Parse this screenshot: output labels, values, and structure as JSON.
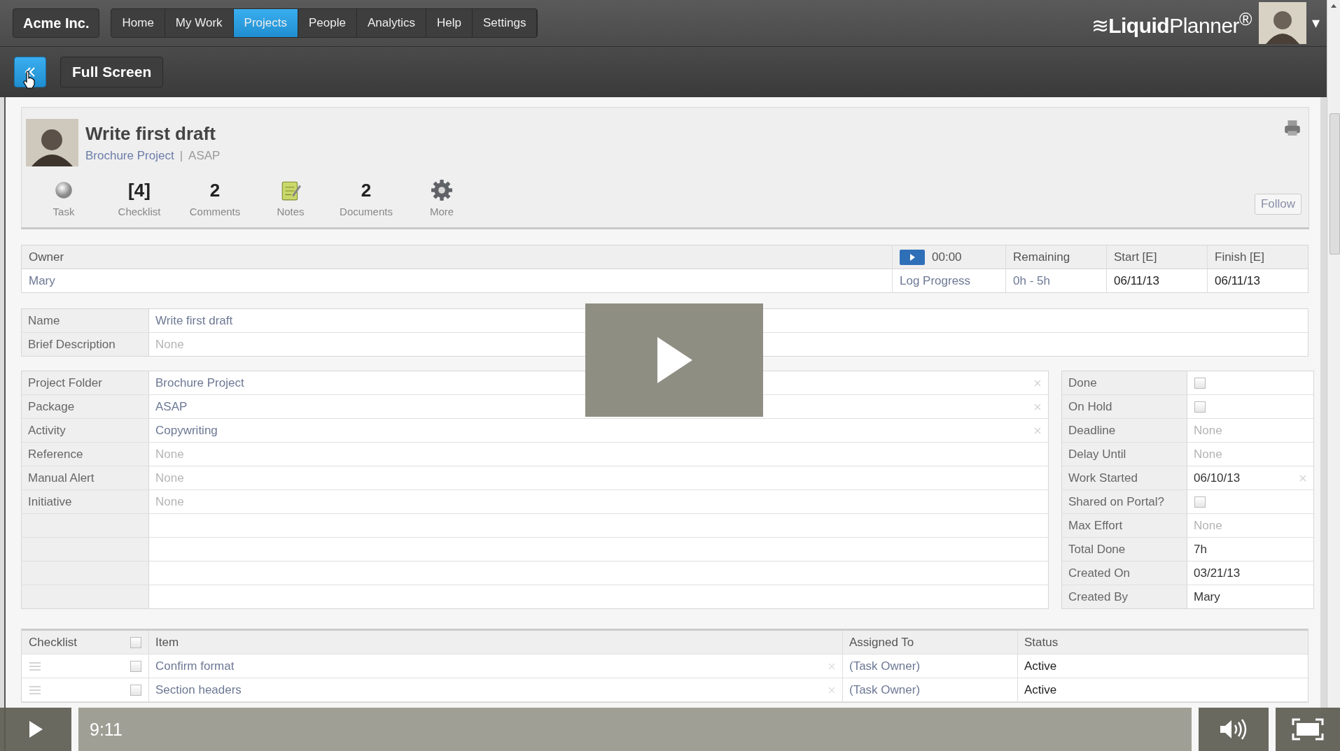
{
  "app": {
    "brand": "Acme Inc.",
    "nav": [
      {
        "label": "Home",
        "selected": false
      },
      {
        "label": "My Work",
        "selected": false
      },
      {
        "label": "Projects",
        "selected": true
      },
      {
        "label": "People",
        "selected": false
      },
      {
        "label": "Analytics",
        "selected": false
      },
      {
        "label": "Help",
        "selected": false
      },
      {
        "label": "Settings",
        "selected": false
      }
    ],
    "full_screen": "Full Screen",
    "logo": "≋**Liquid**Planner$^{®}$",
    "user_menu_caret": "▾",
    "task": {
      "title": "Write first draft",
      "project": "Brochure Project",
      "separator": "|",
      "package": "ASAP",
      "follow": "Follow",
      "stats": [
        {
          "kind": "ball",
          "label": "Task"
        },
        {
          "kind": "count",
          "value": "[4]",
          "label": "Checklist"
        },
        {
          "kind": "count",
          "value": "2",
          "label": "Comments"
        },
        {
          "kind": "notes",
          "label": "Notes"
        },
        {
          "kind": "count",
          "value": "2",
          "label": "Documents"
        },
        {
          "kind": "gear",
          "label": "More"
        }
      ]
    },
    "owner_table": {
      "owner_label": "Owner",
      "owner": "Mary",
      "timer": "00:00",
      "log_progress": "Log Progress",
      "columns": [
        {
          "heading": "Remaining",
          "value": "0h - 5h",
          "strong": false
        },
        {
          "heading": "Start [E]",
          "value": "06/11/13",
          "strong": true
        },
        {
          "heading": "Finish [E]",
          "value": "06/11/13",
          "strong": true
        }
      ]
    },
    "name_fields": [
      {
        "label": "Name",
        "value": "Write first draft",
        "empty": false
      },
      {
        "label": "Brief Description",
        "value": "None",
        "empty": true
      }
    ],
    "left_fields": [
      {
        "label": "Project Folder",
        "value": "Brochure Project",
        "empty": false,
        "clearable": true
      },
      {
        "label": "Package",
        "value": "ASAP",
        "empty": false,
        "clearable": true
      },
      {
        "label": "Activity",
        "value": "Copywriting",
        "empty": false,
        "clearable": true
      },
      {
        "label": "Reference",
        "value": "None",
        "empty": true,
        "clearable": false
      },
      {
        "label": "Manual Alert",
        "value": "None",
        "empty": true,
        "clearable": false
      },
      {
        "label": "Initiative",
        "value": "None",
        "empty": true,
        "clearable": false
      }
    ],
    "right_fields": [
      {
        "label": "Done",
        "kind": "checkbox",
        "checked": false
      },
      {
        "label": "On Hold",
        "kind": "checkbox",
        "checked": false
      },
      {
        "label": "Deadline",
        "kind": "text",
        "value": "None",
        "empty": true,
        "clearable": false
      },
      {
        "label": "Delay Until",
        "kind": "text",
        "value": "None",
        "empty": true,
        "clearable": false
      },
      {
        "label": "Work Started",
        "kind": "text",
        "value": "06/10/13",
        "empty": false,
        "clearable": true
      },
      {
        "label": "Shared on Portal?",
        "kind": "checkbox",
        "checked": false
      },
      {
        "label": "Max Effort",
        "kind": "text",
        "value": "None",
        "empty": true,
        "clearable": false
      },
      {
        "label": "Total Done",
        "kind": "text",
        "value": "7h",
        "empty": false,
        "clearable": false
      },
      {
        "label": "Created On",
        "kind": "text",
        "value": "03/21/13",
        "empty": false,
        "clearable": false
      },
      {
        "label": "Created By",
        "kind": "text",
        "value": "Mary",
        "empty": false,
        "clearable": false
      }
    ],
    "checklist": {
      "columns": [
        "Checklist",
        "Item",
        "Assigned To",
        "Status"
      ],
      "all_checked": false,
      "rows": [
        {
          "item": "Confirm format",
          "assigned": "(Task Owner)",
          "status": "Active",
          "checked": false
        },
        {
          "item": "Section headers",
          "assigned": "(Task Owner)",
          "status": "Active",
          "checked": false
        }
      ]
    }
  },
  "video_player": {
    "paused": true,
    "time": "9:11"
  }
}
